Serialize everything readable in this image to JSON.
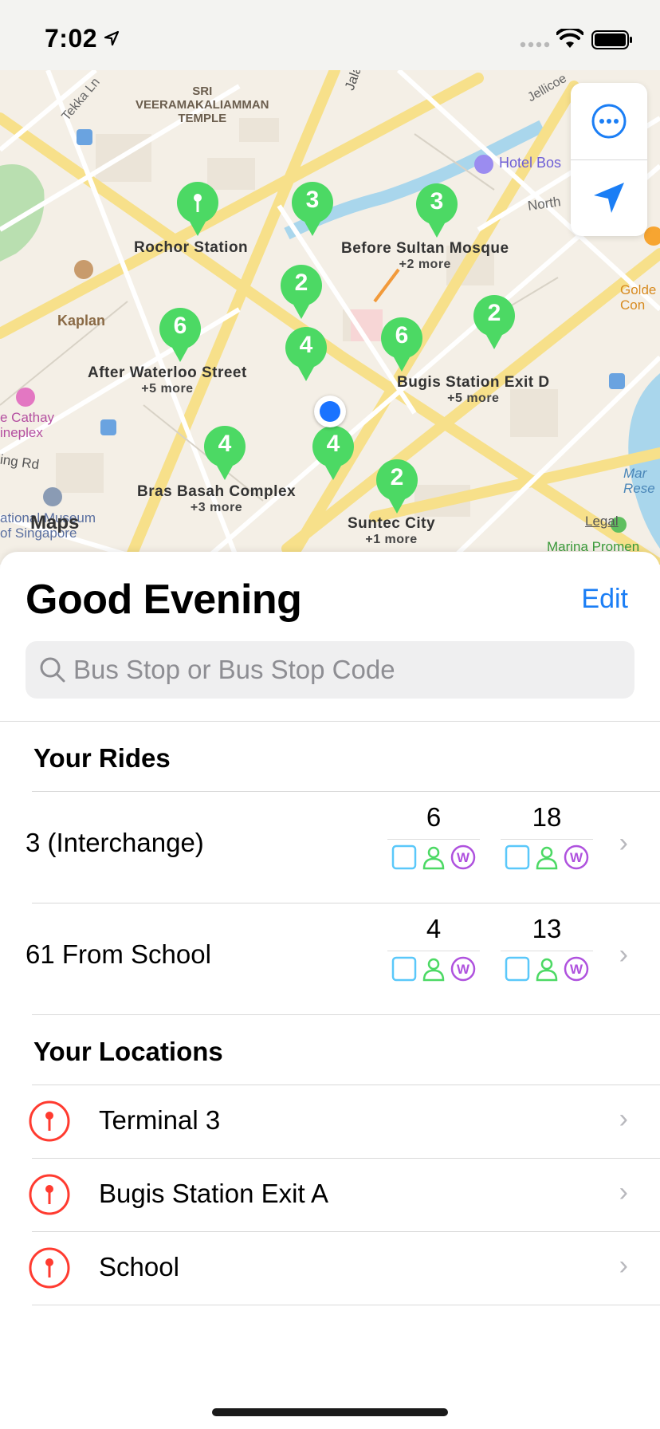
{
  "status_bar": {
    "time": "7:02"
  },
  "map": {
    "landmarks": {
      "sri_temple": "SRI\nVEERAMAKALIAMMAN\nTEMPLE",
      "kaplan": "Kaplan",
      "cathay": "e Cathay\nineplex",
      "hotel": "Hotel Bos",
      "north": "North",
      "golden": "Golde\nCon",
      "marina_res": "Mar\nResе",
      "marina_prom": "Marina Promen",
      "legal": "Legal",
      "maps_logo": "Maps",
      "singapore": "ational Museum\nof Singapore",
      "ing_rd": "ing Rd",
      "jalan": "Jala",
      "tekka": "Tekka Ln",
      "jellicoe": "Jellicoe"
    },
    "stops": [
      {
        "label": "Rochor Station",
        "more": ""
      },
      {
        "label": "Before Sultan Mosque",
        "more": "+2 more"
      },
      {
        "label": "After Waterloo Street",
        "more": "+5 more"
      },
      {
        "label": "Bugis Station Exit D",
        "more": "+5 more"
      },
      {
        "label": "Bras Basah Complex",
        "more": "+3 more"
      },
      {
        "label": "Suntec City",
        "more": "+1 more"
      }
    ],
    "pins": [
      "",
      "3",
      "3",
      "2",
      "6",
      "4",
      "6",
      "2",
      "4",
      "4",
      "2"
    ],
    "pin_color": "#4cd964"
  },
  "sheet": {
    "greeting": "Good Evening",
    "edit_label": "Edit",
    "search_placeholder": "Bus Stop or Bus Stop Code",
    "rides_title": "Your Rides",
    "rides": [
      {
        "name": "3 (Interchange)",
        "arrivals": [
          "6",
          "18"
        ]
      },
      {
        "name": "61 From School",
        "arrivals": [
          "4",
          "13"
        ]
      }
    ],
    "locations_title": "Your Locations",
    "locations": [
      "Terminal 3",
      "Bugis Station Exit A",
      "School"
    ]
  },
  "colors": {
    "accent": "#1b7ef5",
    "pin_green": "#4cd964",
    "location_red": "#ff3b30",
    "seat_cyan": "#5ac8fa",
    "standing_green": "#4cd964",
    "wheelchair_purple": "#af52de"
  },
  "icons": {
    "status": [
      "location-arrow-icon",
      "signal-dots-icon",
      "wifi-icon",
      "battery-icon"
    ],
    "map_controls": [
      "more-icon",
      "location-arrow-icon"
    ],
    "search": "search-icon",
    "ride_features": [
      "seat-icon",
      "standing-icon",
      "wheelchair-icon"
    ],
    "location": "map-pin-icon",
    "disclosure": "chevron-right-icon"
  }
}
